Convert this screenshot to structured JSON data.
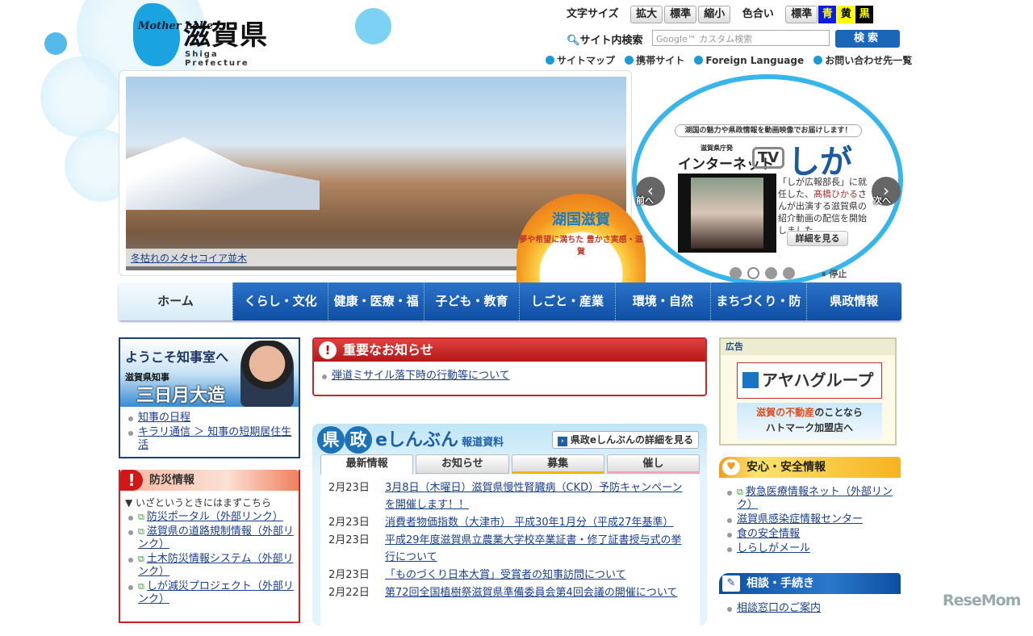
{
  "header": {
    "logo_mark": "Mother Lake",
    "logo_title": "滋賀県",
    "logo_sub": "Shiga Prefecture",
    "font_size_label": "文字サイズ",
    "font_buttons": [
      "拡大",
      "標準",
      "縮小"
    ],
    "color_label": "色合い",
    "color_buttons": [
      "標準",
      "青",
      "黄",
      "黒"
    ],
    "search_label": "サイト内検索",
    "search_placeholder": "Google™ カスタム検索",
    "search_button": "検索",
    "utility_links": [
      "サイトマップ",
      "携帯サイト",
      "Foreign Language",
      "お問い合わせ先一覧"
    ]
  },
  "slideshow": {
    "caption": "冬枯れのメタセコイア並木",
    "stop": "停止",
    "badge_title": "湖国滋賀",
    "badge_sub": "夢や希望に満ちた 豊かさ実感・滋賀"
  },
  "tv": {
    "headline": "湖国の魅力や県政情報を動画映像でお届けします！",
    "dev": "滋賀県庁発",
    "name": "インターネット",
    "tv": "TV",
    "shiga": "しが",
    "text_1": "「しが広報部長」に就任した、",
    "highlight": "髙橋ひかる",
    "text_2": "さんが出演する滋賀県の紹介動画の配信を開始しました。",
    "more": "詳細を見る",
    "prev": "前へ",
    "next": "次へ",
    "stop": "停止",
    "slide_count": 4,
    "active_slide": 2
  },
  "nav": [
    "ホーム",
    "くらし・文化",
    "健康・医療・福祉",
    "子ども・教育",
    "しごと・産業",
    "環境・自然",
    "まちづくり・防災",
    "県政情報"
  ],
  "governor": {
    "welcome": "ようこそ知事室へ",
    "title": "滋賀県知事",
    "name": "三日月大造",
    "links": [
      "知事の日程",
      "キラリ通信 ＞ 知事の短期居住生活"
    ]
  },
  "disaster": {
    "title": "防災情報",
    "sub": "▼ いざというときにはまずこちら",
    "links": [
      "防災ポータル（外部リンク）",
      "滋賀県の道路規制情報（外部リンク）",
      "土木防災情報システム（外部リンク）",
      "しが減災プロジェクト（外部リンク）"
    ]
  },
  "important": {
    "title": "重要なお知らせ",
    "items": [
      "弾道ミサイル落下時の行動等について"
    ]
  },
  "news": {
    "logo_a": "県",
    "logo_b": "政",
    "logo_e": "eしんぶん",
    "logo_sub": "報道資料",
    "more": "県政eしんぶんの詳細を見る",
    "tabs": [
      "最新情報",
      "お知らせ",
      "募集",
      "催し"
    ],
    "items": [
      {
        "date": "2月23日",
        "title": "3月8日（木曜日）滋賀県慢性腎臓病（CKD）予防キャンペーンを開催します！！"
      },
      {
        "date": "2月23日",
        "title": "消費者物価指数（大津市） 平成30年1月分（平成27年基準）"
      },
      {
        "date": "2月23日",
        "title": "平成29年度滋賀県立農業大学校卒業証書・修了証書授与式の挙行について"
      },
      {
        "date": "2月23日",
        "title": "「ものづくり日本大賞」受賞者の知事訪問について"
      },
      {
        "date": "2月22日",
        "title": "第72回全国植樹祭滋賀県準備委員会第4回会議の開催について"
      }
    ]
  },
  "ad": {
    "label": "広告",
    "aya": "アヤハグループ",
    "hato_1a": "滋賀の不動産",
    "hato_1b": "のことなら",
    "hato_2": "ハトマーク加盟店へ"
  },
  "safety": {
    "title": "安心・安全情報",
    "links": [
      "救急医療情報ネット（外部リンク）",
      "滋賀県感染症情報センター",
      "食の安全情報",
      "しらしがメール"
    ]
  },
  "consult": {
    "title": "相談・手続き",
    "links": [
      "相談窓口のご案内"
    ]
  },
  "watermark": "ReseMom"
}
